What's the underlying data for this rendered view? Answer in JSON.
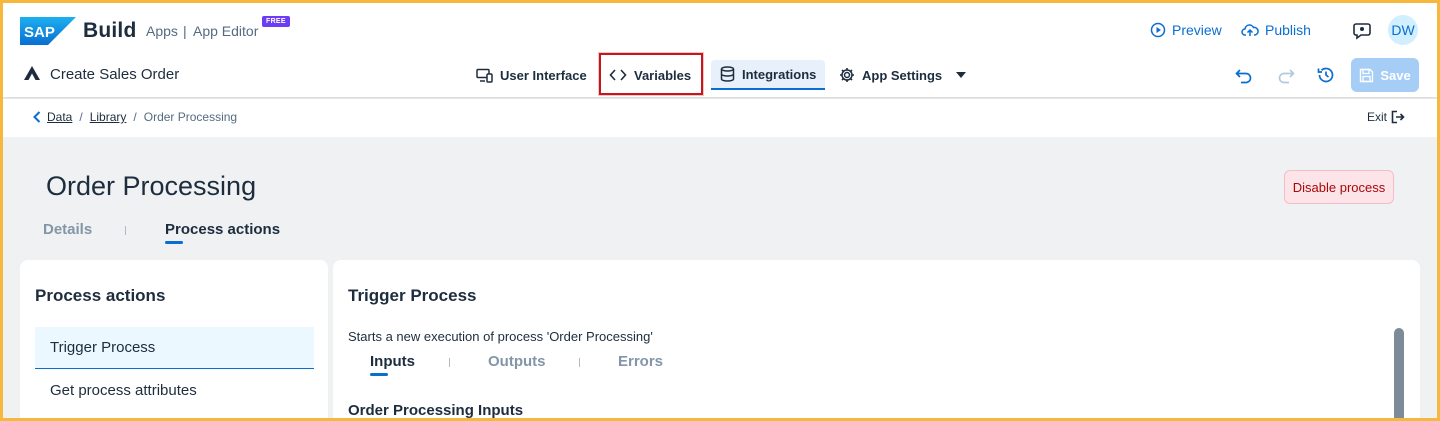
{
  "shell": {
    "brand": {
      "logo_text": "SAP",
      "product": "Build",
      "area": "Apps",
      "separator": "|",
      "editor": "App Editor",
      "badge": "FREE"
    },
    "actions": {
      "preview": "Preview",
      "publish": "Publish"
    },
    "user_initials": "DW",
    "app_title": "Create Sales Order",
    "nav": [
      {
        "label": "User Interface",
        "icon": "monitor-phone-icon"
      },
      {
        "label": "Variables",
        "icon": "code-brackets-icon"
      },
      {
        "label": "Integrations",
        "icon": "database-icon"
      },
      {
        "label": "App Settings",
        "icon": "gear-icon"
      }
    ],
    "save_label": "Save"
  },
  "breadcrumb": {
    "items": [
      "Data",
      "Library"
    ],
    "separator": "/",
    "current": "Order Processing",
    "exit_label": "Exit"
  },
  "page": {
    "title": "Order Processing",
    "disable_label": "Disable process",
    "tabs": {
      "details": "Details",
      "process_actions": "Process actions"
    }
  },
  "left_panel": {
    "title": "Process actions",
    "items": [
      "Trigger Process",
      "Get process attributes"
    ]
  },
  "right_panel": {
    "title": "Trigger Process",
    "description": "Starts a new execution of process 'Order Processing'",
    "tabs": [
      "Inputs",
      "Outputs",
      "Errors"
    ],
    "section_title": "Order Processing Inputs"
  },
  "colors": {
    "accent": "#0a6ed1",
    "highlight": "#c4161c",
    "badge": "#6c3df2",
    "danger_text": "#aa0808"
  }
}
